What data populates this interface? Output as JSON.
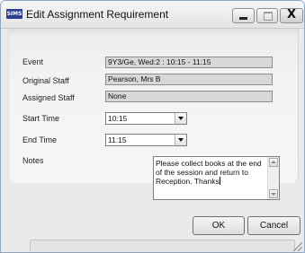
{
  "window": {
    "app_badge": "SIMS",
    "title": "Edit Assignment Requirement",
    "controls": {
      "minimize_icon": "minimize-icon",
      "maximize_icon": "maximize-icon",
      "close_icon": "close-icon",
      "close_glyph": "X"
    }
  },
  "form": {
    "event": {
      "label": "Event",
      "value": "9Y3/Ge, Wed:2 : 10:15 - 11:15"
    },
    "original_staff": {
      "label": "Original Staff",
      "value": "Pearson, Mrs B"
    },
    "assigned_staff": {
      "label": "Assigned Staff",
      "value": "None"
    },
    "start_time": {
      "label": "Start Time",
      "value": "10:15"
    },
    "end_time": {
      "label": "End Time",
      "value": "11:15"
    },
    "notes": {
      "label": "Notes",
      "value": "Please collect books at the end of the session and return to Reception.  Thanks"
    }
  },
  "buttons": {
    "ok": "OK",
    "cancel": "Cancel"
  },
  "colors": {
    "app_badge": "#2a3d8f",
    "readonly_field": "#d8d8d8",
    "dialog_background": "#eaeaea"
  }
}
